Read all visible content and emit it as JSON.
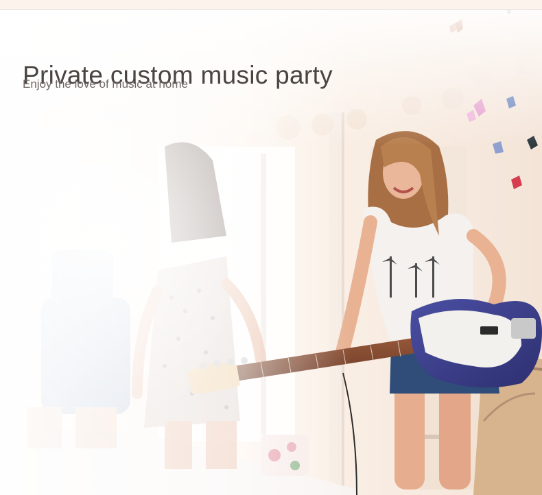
{
  "banner": {
    "title": "Private custom music party",
    "subtitle": "Enjoy the love of music at home"
  },
  "photo": {
    "subject": "three-girls-playing-bass-guitar-in-bedroom",
    "palette": {
      "wall": "#f7ece3",
      "shirt": "#f4f1ee",
      "shorts": "#2f4d78",
      "guitar_body": "#3b3f8c",
      "pickguard": "#f3f1ee",
      "hair": "#b9804f",
      "skin": "#e8b293"
    }
  }
}
